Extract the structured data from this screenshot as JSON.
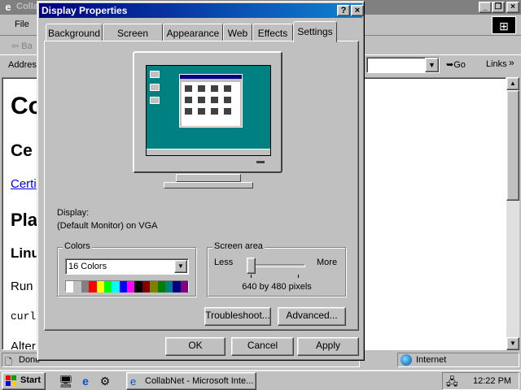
{
  "ie": {
    "title": "Colla",
    "menu_file": "File",
    "back_label": "Ba",
    "address_label": "Addres",
    "go_label": "Go",
    "links_label": "Links",
    "content": {
      "h1": "Co",
      "h2": "Ce",
      "link": "Certi",
      "h2b": "Pla",
      "h3": "Linu",
      "p1": "Run t",
      "code": "curl",
      "p2": "Alter"
    },
    "status_text": "Done",
    "zone_text": "Internet"
  },
  "taskbar": {
    "start_label": "Start",
    "task_label": "CollabNet - Microsoft Inte...",
    "clock": "12:22 PM"
  },
  "dialog": {
    "title": "Display Properties",
    "tabs": [
      "Background",
      "Screen Saver",
      "Appearance",
      "Web",
      "Effects",
      "Settings"
    ],
    "active_tab": "Settings",
    "display_label": "Display:",
    "display_value": "(Default Monitor) on VGA",
    "colors_group": "Colors",
    "colors_value": "16 Colors",
    "palette": [
      "#ffffff",
      "#c0c0c0",
      "#808080",
      "#ff0000",
      "#ffff00",
      "#00ff00",
      "#00ffff",
      "#0000ff",
      "#ff00ff",
      "#000000",
      "#800000",
      "#808000",
      "#008000",
      "#008080",
      "#000080",
      "#800080"
    ],
    "screen_area_group": "Screen area",
    "less_label": "Less",
    "more_label": "More",
    "resolution": "640 by 480 pixels",
    "slider_position": 0,
    "troubleshoot_label": "Troubleshoot...",
    "advanced_label": "Advanced...",
    "ok_label": "OK",
    "cancel_label": "Cancel",
    "apply_label": "Apply"
  }
}
